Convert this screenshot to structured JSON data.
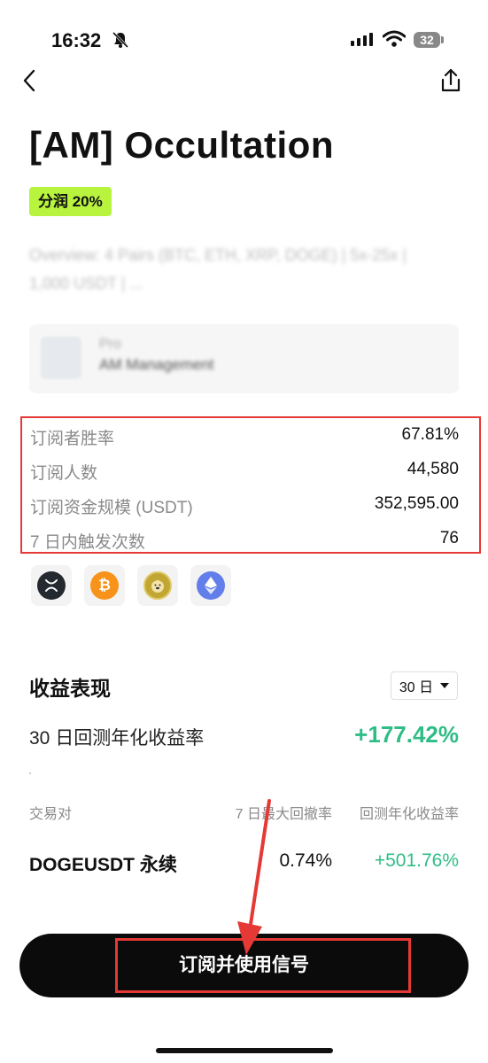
{
  "status_bar": {
    "time": "16:32",
    "battery": "32"
  },
  "header": {
    "title": "[AM] Occultation",
    "badge": "分润 20%"
  },
  "overview": {
    "line1": "Overview: 4 Pairs (BTC, ETH, XRP, DOGE) | 5x-25x |",
    "line2": "1,000 USDT | ..."
  },
  "provider": {
    "name": "Pro",
    "subtitle": "AM Management"
  },
  "stats": [
    {
      "label": "订阅者胜率",
      "value": "67.81%"
    },
    {
      "label": "订阅人数",
      "value": "44,580"
    },
    {
      "label": "订阅资金规模 (USDT)",
      "value": "352,595.00"
    },
    {
      "label": "7 日内触发次数",
      "value": "76"
    }
  ],
  "coins": [
    "xrp-icon",
    "btc-icon",
    "doge-icon",
    "eth-icon"
  ],
  "performance": {
    "title": "收益表现",
    "period": "30 日",
    "apr_label": "30 日回测年化收益率",
    "apr_value": "+177.42%",
    "columns": [
      "交易对",
      "7 日最大回撤率",
      "回测年化收益率"
    ],
    "rows": [
      {
        "pair": "DOGEUSDT 永续",
        "drawdown": "0.74%",
        "apr": "+501.76%"
      }
    ]
  },
  "cta": {
    "label": "订阅并使用信号"
  },
  "colors": {
    "accent_green": "#2ebd85",
    "badge_bg": "#b8f33d",
    "highlight_red": "#e53935"
  }
}
